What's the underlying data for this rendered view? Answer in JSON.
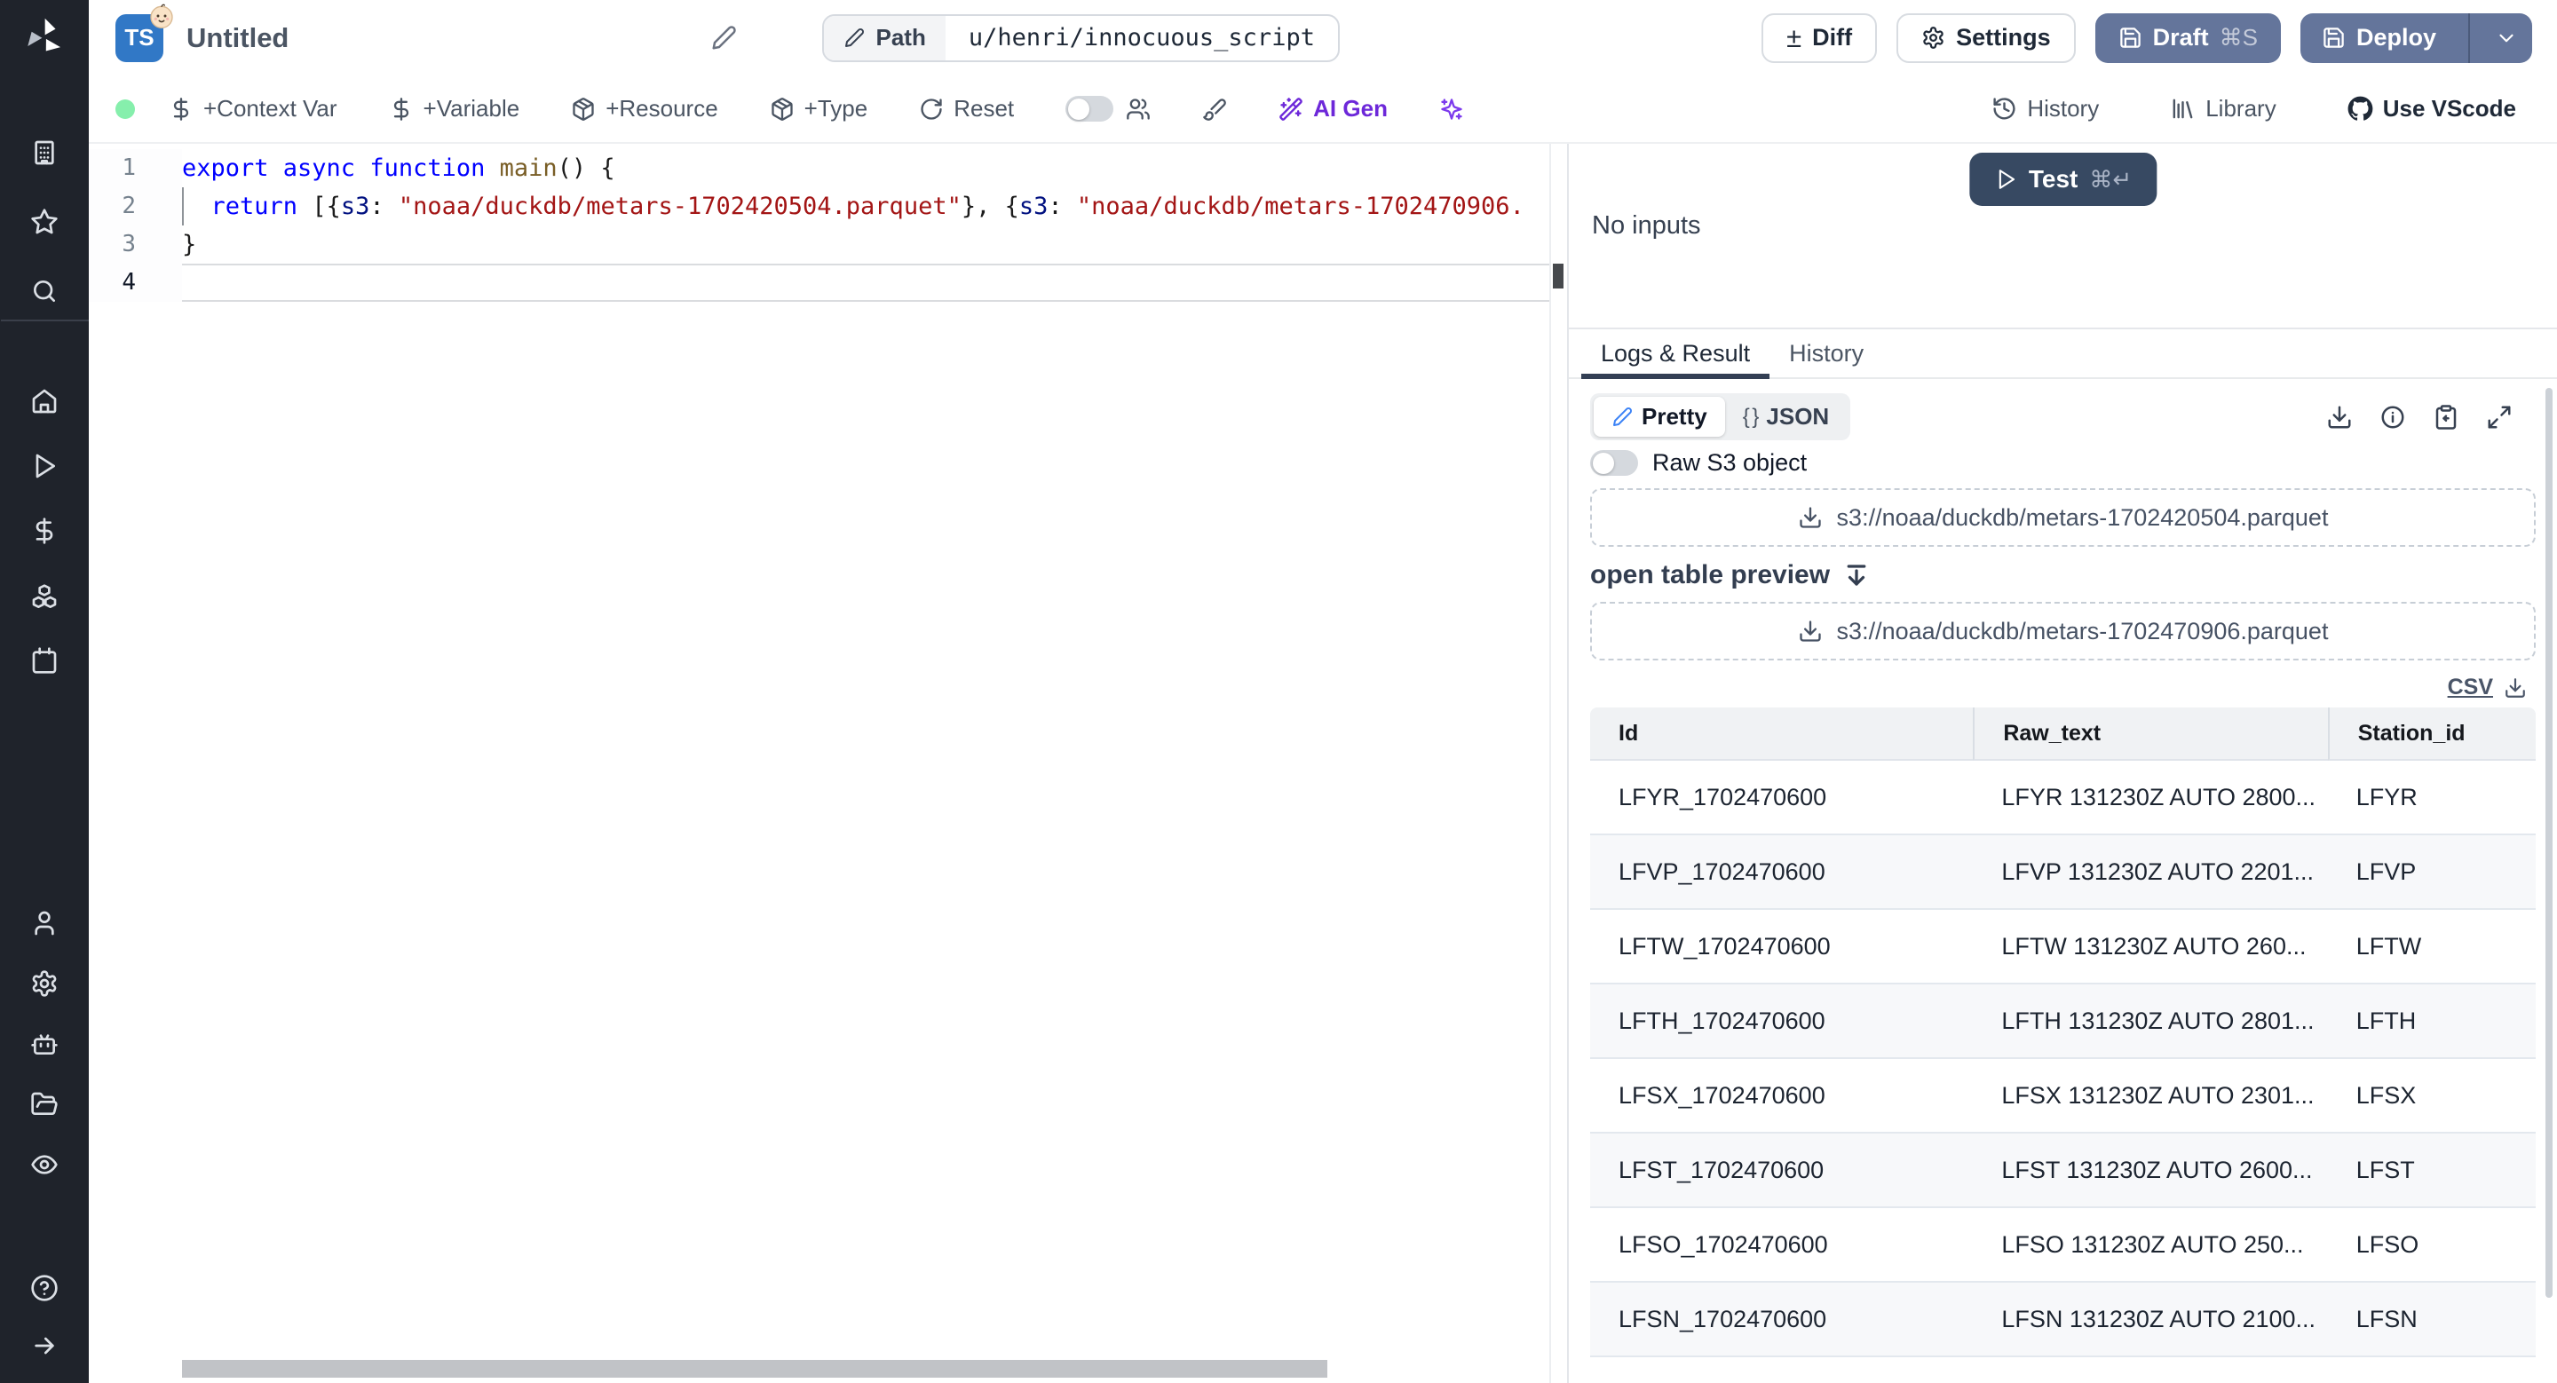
{
  "colors": {
    "slate-button": "#64759b",
    "test-button": "#374962",
    "ai-purple": "#6d28d9",
    "green-dot": "#86efac",
    "pen-blue": "#3b82f6",
    "ts-badge": "#3178c6"
  },
  "glyphs": {
    "plus_minus": "±",
    "braces": "{ }"
  },
  "sidebar": {
    "icon_names": [
      "windmill-logo",
      "building",
      "star",
      "search",
      "home",
      "play",
      "dollar-sign",
      "boxes",
      "calendar",
      "user",
      "gear",
      "robot",
      "folder-open",
      "eye",
      "help-circle",
      "arrow-right"
    ]
  },
  "header": {
    "lang_badge": "TS",
    "title": "Untitled",
    "path_label": "Path",
    "path_value": "u/henri/innocuous_script",
    "diff_label": "Diff",
    "settings_label": "Settings",
    "draft_label": "Draft",
    "draft_shortcut": "⌘S",
    "deploy_label": "Deploy"
  },
  "toolbar": {
    "add_context_var": "+Context Var",
    "add_variable": "+Variable",
    "add_resource": "+Resource",
    "add_type": "+Type",
    "reset": "Reset",
    "ai_gen": "AI Gen",
    "history": "History",
    "library": "Library",
    "use_vscode": "Use VScode"
  },
  "editor": {
    "line_numbers": [
      "1",
      "2",
      "3",
      "4"
    ],
    "active_line": "4",
    "lines": [
      [
        {
          "t": "export async function ",
          "c": "kw"
        },
        {
          "t": "main",
          "c": "fn"
        },
        {
          "t": "() {",
          "c": "pl"
        }
      ],
      [
        {
          "t": "  ",
          "c": "pl"
        },
        {
          "t": "return",
          "c": "kw"
        },
        {
          "t": " [{",
          "c": "pl"
        },
        {
          "t": "s3",
          "c": "prop"
        },
        {
          "t": ": ",
          "c": "pl"
        },
        {
          "t": "\"noaa/duckdb/metars-1702420504.parquet\"",
          "c": "str"
        },
        {
          "t": "}, {",
          "c": "pl"
        },
        {
          "t": "s3",
          "c": "prop"
        },
        {
          "t": ": ",
          "c": "pl"
        },
        {
          "t": "\"noaa/duckdb/metars-1702470906.",
          "c": "str"
        }
      ],
      [
        {
          "t": "}",
          "c": "pl"
        }
      ],
      []
    ]
  },
  "run_panel": {
    "test_label": "Test",
    "test_shortcut": "⌘↵",
    "no_inputs": "No inputs",
    "tab_logs": "Logs & Result",
    "tab_history": "History",
    "pretty_label": "Pretty",
    "json_label": "JSON",
    "raw_s3_label": "Raw S3 object",
    "s3_files": [
      "s3://noaa/duckdb/metars-1702420504.parquet",
      "s3://noaa/duckdb/metars-1702470906.parquet"
    ],
    "open_table_preview": "open table preview",
    "csv_label": "CSV",
    "table": {
      "columns": [
        "Id",
        "Raw_text",
        "Station_id"
      ],
      "rows": [
        [
          "LFYR_1702470600",
          "LFYR 131230Z AUTO 2800...",
          "LFYR"
        ],
        [
          "LFVP_1702470600",
          "LFVP 131230Z AUTO 2201...",
          "LFVP"
        ],
        [
          "LFTW_1702470600",
          "LFTW 131230Z AUTO 260...",
          "LFTW"
        ],
        [
          "LFTH_1702470600",
          "LFTH 131230Z AUTO 2801...",
          "LFTH"
        ],
        [
          "LFSX_1702470600",
          "LFSX 131230Z AUTO 2301...",
          "LFSX"
        ],
        [
          "LFST_1702470600",
          "LFST 131230Z AUTO 2600...",
          "LFST"
        ],
        [
          "LFSO_1702470600",
          "LFSO 131230Z AUTO 250...",
          "LFSO"
        ],
        [
          "LFSN_1702470600",
          "LFSN 131230Z AUTO 2100...",
          "LFSN"
        ]
      ]
    }
  }
}
